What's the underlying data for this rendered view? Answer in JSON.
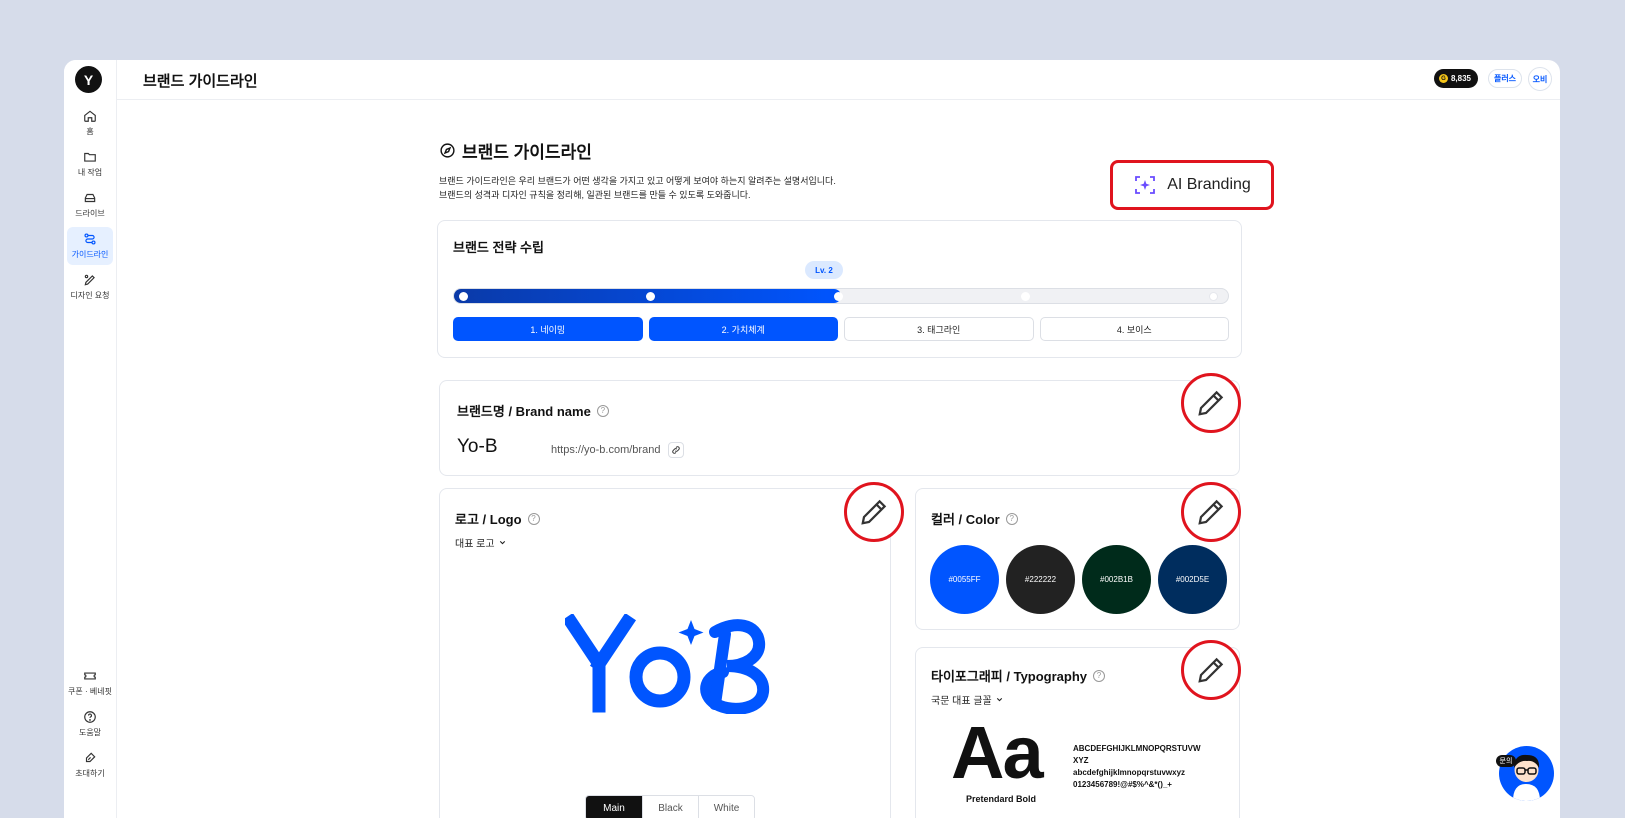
{
  "topbar": {
    "title": "브랜드 가이드라인",
    "points": "8,835",
    "coin_symbol": "G",
    "plus_label": "플러스",
    "user_label": "오비"
  },
  "sidebar": {
    "logo": "Y",
    "items": [
      {
        "label": "홈",
        "icon": "home-icon"
      },
      {
        "label": "내 작업",
        "icon": "folder-icon"
      },
      {
        "label": "드라이브",
        "icon": "drive-icon"
      },
      {
        "label": "가이드라인",
        "icon": "guideline-icon",
        "active": true
      },
      {
        "label": "디자인 요청",
        "icon": "design-request-icon"
      }
    ],
    "bottom_items": [
      {
        "label": "쿠폰 · 베네핏",
        "icon": "ticket-icon"
      },
      {
        "label": "도움말",
        "icon": "help-icon"
      },
      {
        "label": "초대하기",
        "icon": "invite-icon"
      }
    ]
  },
  "main": {
    "title": "브랜드 가이드라인",
    "desc_line1": "브랜드 가이드라인은 우리 브랜드가 어떤 생각을 가지고 있고 어떻게 보여야 하는지 알려주는 설명서입니다.",
    "desc_line2": "브랜드의 성격과 디자인 규칙을 정리해, 일관된 브랜드를 만들 수 있도록 도와줍니다.",
    "ai_button": "AI Branding"
  },
  "strategy": {
    "title": "브랜드 전략 수립",
    "level": "Lv. 2",
    "progress": 0.5,
    "steps": [
      {
        "label": "1. 네이밍",
        "done": true
      },
      {
        "label": "2. 가치체계",
        "done": true
      },
      {
        "label": "3. 태그라인",
        "done": false
      },
      {
        "label": "4. 보이스",
        "done": false
      }
    ]
  },
  "brand_name": {
    "title": "브랜드명 / Brand name",
    "help": "?",
    "value": "Yo-B",
    "url": "https://yo-b.com/brand"
  },
  "logo": {
    "title": "로고 / Logo",
    "help": "?",
    "dropdown": "대표 로고",
    "variants": [
      "Main",
      "Black",
      "White"
    ],
    "active_variant": "Main",
    "logo_color": "#0055FF"
  },
  "color": {
    "title": "컬러 / Color",
    "help": "?",
    "swatches": [
      {
        "hex": "#0055FF"
      },
      {
        "hex": "#222222"
      },
      {
        "hex": "#002B1B"
      },
      {
        "hex": "#002D5E"
      }
    ]
  },
  "typography": {
    "title": "타이포그래피 / Typography",
    "help": "?",
    "dropdown": "국문 대표 글꼴",
    "specimen": "Aa",
    "font_name": "Pretendard Bold",
    "sample_upper": "ABCDEFGHIJKLMNOPQRSTUVWXYZ",
    "sample_lower": "abcdefghijklmnopqrstuvwxyz",
    "sample_numbers": "0123456789!@#$%^&*()_+"
  },
  "chat": {
    "tag": "문의"
  },
  "colors": {
    "accent": "#0055FF",
    "highlight_red": "#E0141E"
  }
}
